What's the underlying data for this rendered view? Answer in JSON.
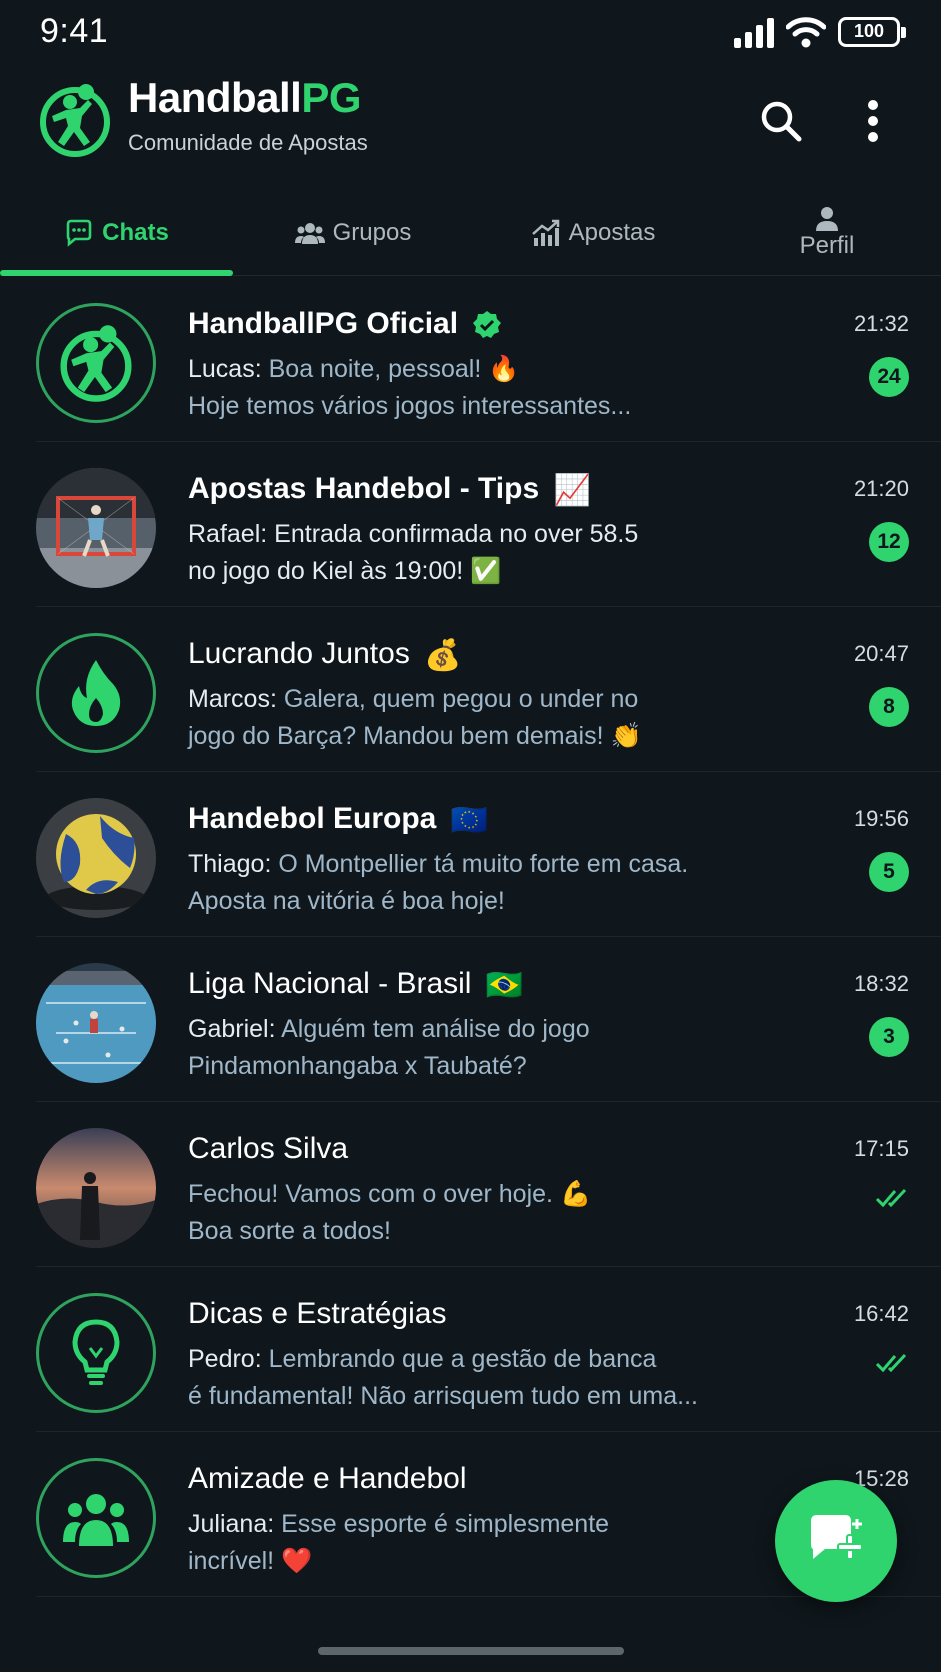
{
  "status_bar": {
    "time": "9:41",
    "battery": "100"
  },
  "header": {
    "brand_main": "Handball",
    "brand_accent": "PG",
    "subtitle": "Comunidade de Apostas"
  },
  "tabs": [
    {
      "label": "Chats",
      "active": true,
      "icon": "chat-icon"
    },
    {
      "label": "Grupos",
      "active": false,
      "icon": "groups-icon"
    },
    {
      "label": "Apostas",
      "active": false,
      "icon": "chart-icon"
    },
    {
      "label": "Perfil",
      "active": false,
      "icon": "person-icon"
    }
  ],
  "chats": [
    {
      "name": "HandballPG Oficial",
      "sender": "Lucas:",
      "line1": " Boa noite, pessoal! ",
      "emoji1": "🔥",
      "line2": "Hoje temos vários jogos interessantes...",
      "time": "21:32",
      "badge": "24",
      "avatar": "logo",
      "verified": true
    },
    {
      "name": "Apostas Handebol - Tips",
      "name_emoji": "📈",
      "sender": "Rafael:",
      "line1": " Entrada confirmada no over 58.5",
      "line2": "no jogo do Kiel às 19:00! ",
      "emoji2": "✅",
      "time": "21:20",
      "badge": "12",
      "avatar": "goal-photo"
    },
    {
      "name": "Lucrando Juntos",
      "name_emoji": "💰",
      "sender": "Marcos:",
      "line1": " Galera, quem pegou o under no",
      "line2": "jogo do Barça? Mandou bem demais! ",
      "emoji2": "👏",
      "time": "20:47",
      "badge": "8",
      "avatar": "fire"
    },
    {
      "name": "Handebol Europa",
      "name_emoji": "🇪🇺",
      "sender": "Thiago:",
      "line1": " O Montpellier tá muito forte em casa.",
      "line2": "Aposta na vitória é boa hoje!",
      "time": "19:56",
      "badge": "5",
      "avatar": "ball-photo"
    },
    {
      "name": "Liga Nacional - Brasil",
      "name_emoji": "🇧🇷",
      "sender": "Gabriel:",
      "line1": " Alguém tem análise do jogo",
      "line2": "Pindamonhangaba x Taubaté?",
      "time": "18:32",
      "badge": "3",
      "avatar": "court-photo"
    },
    {
      "name": "Carlos Silva",
      "sender": "",
      "line1": "Fechou! Vamos com o over hoje. ",
      "emoji1": "💪",
      "line2": "Boa sorte a todos!",
      "time": "17:15",
      "badge": "",
      "avatar": "sunset-photo"
    },
    {
      "name": "Dicas e Estratégias",
      "sender": "Pedro:",
      "line1": " Lembrando que a gestão de banca",
      "line2": "é fundamental! Não arrisquem tudo em uma...",
      "time": "16:42",
      "badge": "",
      "avatar": "bulb"
    },
    {
      "name": "Amizade e Handebol",
      "sender": "Juliana:",
      "line1": " Esse esporte é simplesmente",
      "line2": "incrível! ",
      "emoji2": "❤️",
      "time": "15:28",
      "badge": "",
      "avatar": "people"
    }
  ],
  "colors": {
    "accent": "#2fd46f",
    "background": "#0f171c",
    "preview_text": "#9fb7c9"
  }
}
